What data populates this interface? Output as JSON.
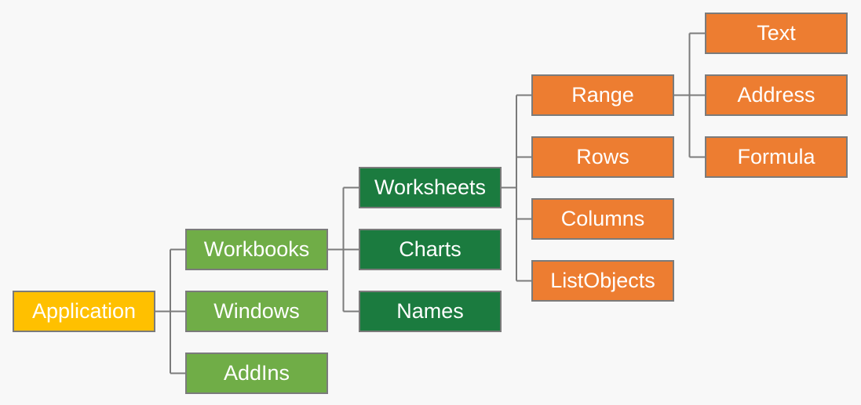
{
  "colors": {
    "level0": "#FFC000",
    "level1": "#70AD47",
    "level2": "#1B7B3F",
    "level3": "#ED7D31",
    "level4": "#ED7D31",
    "connector": "#7b7b7b"
  },
  "nodes": [
    {
      "id": "application",
      "label": "Application",
      "level": 0,
      "parent": null
    },
    {
      "id": "workbooks",
      "label": "Workbooks",
      "level": 1,
      "parent": "application"
    },
    {
      "id": "windows",
      "label": "Windows",
      "level": 1,
      "parent": "application"
    },
    {
      "id": "addins",
      "label": "AddIns",
      "level": 1,
      "parent": "application"
    },
    {
      "id": "worksheets",
      "label": "Worksheets",
      "level": 2,
      "parent": "workbooks"
    },
    {
      "id": "charts",
      "label": "Charts",
      "level": 2,
      "parent": "workbooks"
    },
    {
      "id": "names",
      "label": "Names",
      "level": 2,
      "parent": "workbooks"
    },
    {
      "id": "range",
      "label": "Range",
      "level": 3,
      "parent": "worksheets"
    },
    {
      "id": "rows",
      "label": "Rows",
      "level": 3,
      "parent": "worksheets"
    },
    {
      "id": "columns",
      "label": "Columns",
      "level": 3,
      "parent": "worksheets"
    },
    {
      "id": "listobjects",
      "label": "ListObjects",
      "level": 3,
      "parent": "worksheets"
    },
    {
      "id": "text",
      "label": "Text",
      "level": 4,
      "parent": "range"
    },
    {
      "id": "address",
      "label": "Address",
      "level": 4,
      "parent": "range"
    },
    {
      "id": "formula",
      "label": "Formula",
      "level": 4,
      "parent": "range"
    }
  ]
}
